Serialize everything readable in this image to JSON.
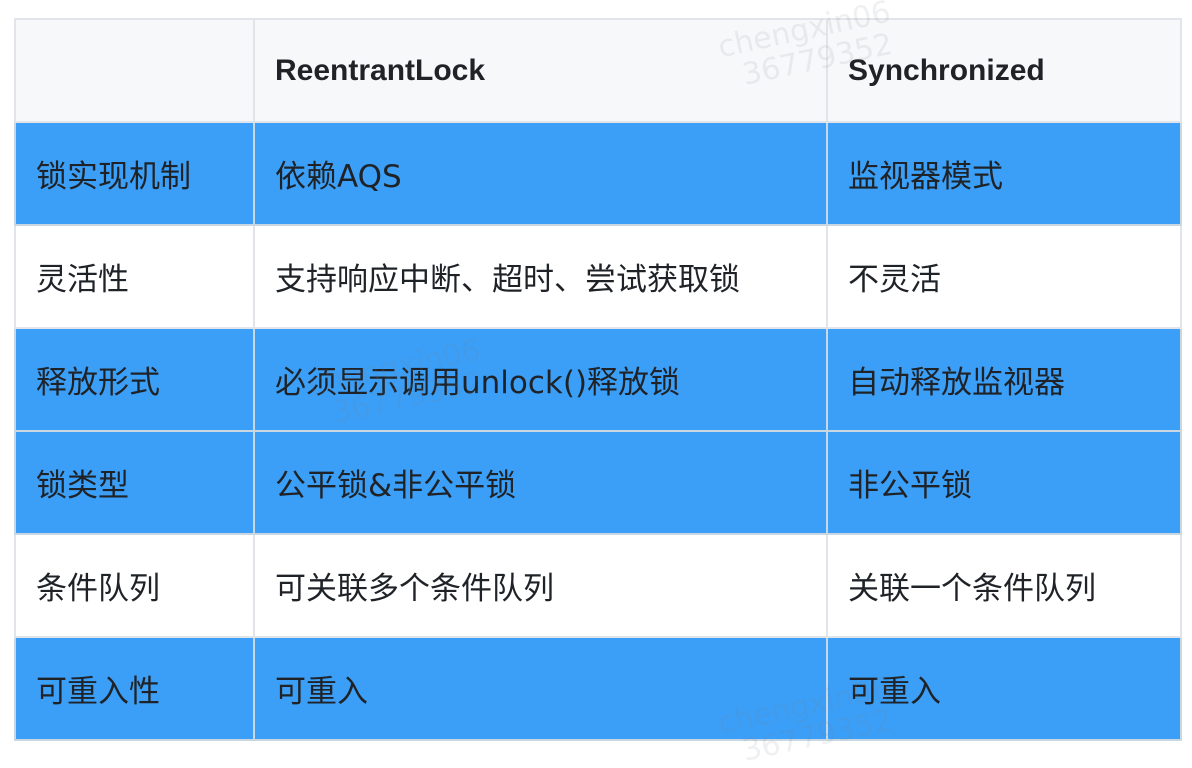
{
  "table": {
    "headers": [
      "",
      "ReentrantLock",
      "Synchronized"
    ],
    "rows": [
      {
        "feature": "锁实现机制",
        "reentrant": "依赖AQS",
        "sync": "监视器模式",
        "highlight": true
      },
      {
        "feature": "灵活性",
        "reentrant": "支持响应中断、超时、尝试获取锁",
        "sync": "不灵活",
        "highlight": false
      },
      {
        "feature": "释放形式",
        "reentrant": "必须显示调用unlock()释放锁",
        "sync": "自动释放监视器",
        "highlight": true
      },
      {
        "feature": "锁类型",
        "reentrant": "公平锁&非公平锁",
        "sync": "非公平锁",
        "highlight": true
      },
      {
        "feature": "条件队列",
        "reentrant": "可关联多个条件队列",
        "sync": "关联一个条件队列",
        "highlight": false
      },
      {
        "feature": "可重入性",
        "reentrant": "可重入",
        "sync": "可重入",
        "highlight": true
      }
    ]
  },
  "watermark": {
    "name": "chengxin06",
    "id": "36779352"
  },
  "colors": {
    "highlight_row": "#3b9ff7",
    "header_bg": "#f6f8fa",
    "border": "#e1e4e8",
    "text": "#1f2328"
  }
}
